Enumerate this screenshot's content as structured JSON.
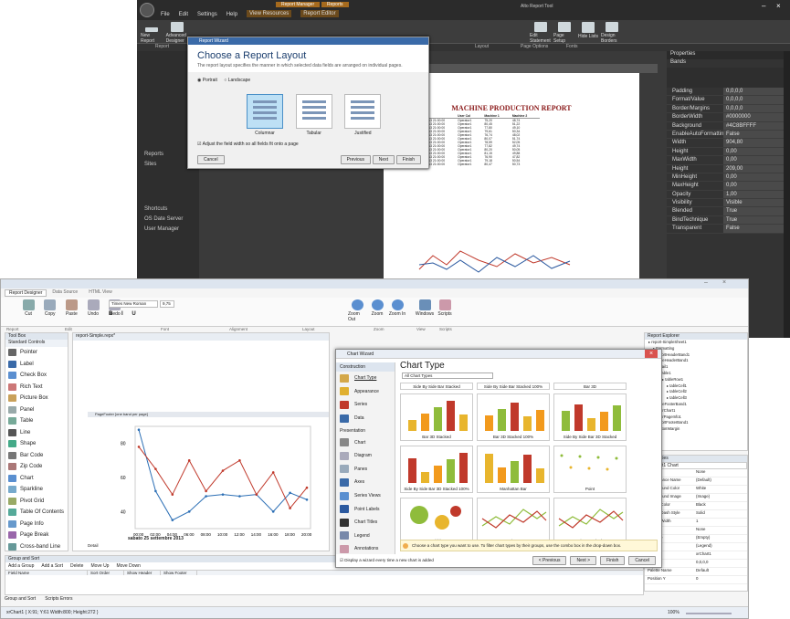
{
  "dark_window": {
    "tabs": [
      "File",
      "Edit",
      "Settings",
      "Help",
      "View Resources",
      "Report Editor"
    ],
    "context_tabs": [
      "Report Manager",
      "Reports"
    ],
    "title": "Alto Report Tool",
    "ribbon_groups": [
      "Report",
      "Layout",
      "Page Options",
      "Fonts"
    ],
    "ribbon_buttons": [
      "New Report Wizard",
      "Advanced Designer",
      "Edit Statement",
      "Page Setup",
      "Hide Lists",
      "Design Borders"
    ],
    "left_tree": [
      "Reports",
      "Sites",
      "Shortcuts",
      "OS Date Server",
      "User Manager"
    ],
    "report_title": "MACHINE PRODUCTION REPORT",
    "report_columns": [
      "Date Col",
      "User Col",
      "Machine 1",
      "Machine 2"
    ],
    "report_rows": [
      [
        "19/02/2013 21:00:00",
        "Operator1",
        "75,20",
        "48,74"
      ],
      [
        "19/02/2013 21:00:00",
        "Operator1",
        "80,45",
        "51,22"
      ],
      [
        "19/02/2013 21:00:00",
        "Operator1",
        "77,80",
        "49,10"
      ],
      [
        "19/02/2013 21:00:00",
        "Operator1",
        "79,61",
        "50,34"
      ],
      [
        "19/02/2013 21:00:00",
        "Operator1",
        "76,74",
        "48,02"
      ],
      [
        "19/02/2013 21:00:00",
        "Operator1",
        "80,07",
        "51,74"
      ],
      [
        "19/02/2013 21:00:00",
        "Operator1",
        "78,59",
        "52,05"
      ],
      [
        "19/02/2013 21:00:00",
        "Operator1",
        "77,82",
        "49,74"
      ],
      [
        "19/02/2013 21:00:00",
        "Operator1",
        "80,20",
        "50,05"
      ],
      [
        "19/02/2013 21:00:00",
        "Operator1",
        "81,15",
        "49,88"
      ],
      [
        "19/02/2013 21:00:00",
        "Operator1",
        "76,90",
        "47,82"
      ],
      [
        "19/02/2013 21:00:00",
        "Operator1",
        "79,18",
        "50,54"
      ],
      [
        "19/02/2013 21:00:00",
        "Operator1",
        "80,47",
        "50,73"
      ]
    ],
    "properties_title": "Properties",
    "properties_section": "Bands",
    "properties": [
      [
        "Padding",
        "0,0,0,0"
      ],
      [
        "Format/Value",
        "0,0,0,0"
      ],
      [
        "Border/Margins",
        "0,0,0,0"
      ],
      [
        "BorderWidth",
        "#0000000"
      ],
      [
        "Background",
        "#4C8BFFFF"
      ],
      [
        "EnableAutoFormatting",
        "False"
      ],
      [
        "Width",
        "904,80"
      ],
      [
        "Height",
        "0,00"
      ],
      [
        "MaxWidth",
        "0,00"
      ],
      [
        "Height",
        "209,00"
      ],
      [
        "MinHeight",
        "0,00"
      ],
      [
        "MaxHeight",
        "0,00"
      ],
      [
        "Opacity",
        "1,00"
      ],
      [
        "Visibility",
        "Visible"
      ],
      [
        "Blended",
        "True"
      ],
      [
        "BindTechnique",
        "True"
      ],
      [
        "Transparent",
        "False"
      ]
    ]
  },
  "report_wizard": {
    "window_title": "Report Wizard",
    "title": "Choose a Report Layout",
    "subtitle": "The report layout specifies the manner in which selected data fields are arranged on individual pages.",
    "orientation_options": [
      "Portrait",
      "Landscape"
    ],
    "layouts": [
      "Columnar",
      "Tabular",
      "Justified"
    ],
    "adjust_label": "Adjust the field width so all fields fit onto a page",
    "buttons": [
      "Cancel",
      "Previous",
      "Next",
      "Finish"
    ]
  },
  "light_window": {
    "tabs": [
      "Report Designer",
      "Data Source",
      "HTML View"
    ],
    "ribbon_buttons": [
      "Cut",
      "Copy",
      "Paste",
      "Undo",
      "Redo",
      "Zoom Out",
      "Zoom",
      "Zoom In",
      "Windows",
      "Scripts"
    ],
    "ribbon_groups": [
      "Report",
      "Edit",
      "Font",
      "Alignment",
      "Layout",
      "Zoom",
      "View",
      "Scripts"
    ],
    "font_name": "Times New Roman",
    "font_size": "9,75",
    "document_tab": "report-Simple.repx*",
    "toolbox_title": "Tool Box",
    "toolbox_section": "Standard Controls",
    "toolbox_items": [
      "Pointer",
      "Label",
      "Check Box",
      "Rich Text",
      "Picture Box",
      "Panel",
      "Table",
      "Line",
      "Shape",
      "Bar Code",
      "Zip Code",
      "Chart",
      "Sparkline",
      "Pivot Grid",
      "Table Of Contents",
      "Page Info",
      "Page Break",
      "Cross-band Line"
    ],
    "band_label": "PageFooter [one band per page]",
    "chart_date": "sabato 25 settembre 2013",
    "detail_label": "Detail",
    "chart_points_blue": [
      [
        "00:00",
        88
      ],
      [
        "02:00",
        52
      ],
      [
        "04:00",
        35
      ],
      [
        "06:00",
        40
      ],
      [
        "08:00",
        49
      ],
      [
        "10:00",
        50
      ],
      [
        "12:00",
        49
      ],
      [
        "14:00",
        50
      ],
      [
        "16:00",
        40
      ],
      [
        "18:00",
        51
      ],
      [
        "20:00",
        47
      ]
    ],
    "chart_points_red": [
      [
        "00:00",
        78
      ],
      [
        "02:00",
        65
      ],
      [
        "04:00",
        50
      ],
      [
        "06:00",
        70
      ],
      [
        "08:00",
        52
      ],
      [
        "10:00",
        64
      ],
      [
        "12:00",
        70
      ],
      [
        "14:00",
        50
      ],
      [
        "16:00",
        63
      ],
      [
        "18:00",
        42
      ],
      [
        "20:00",
        54
      ]
    ],
    "group_sort_title": "Group and Sort",
    "group_buttons": [
      "Add a Group",
      "Add a Sort",
      "Delete",
      "Move Up",
      "Move Down"
    ],
    "group_columns": [
      "Field Name",
      "Sort Order",
      "Show Header",
      "Show Footer"
    ],
    "bottom_tabs": [
      "Group and Sort",
      "Scripts Errors"
    ],
    "status_text": "xrChart1 { X:91; Y:61 Width:800; Height:272 }",
    "zoom": "100%",
    "explorer_title": "Report Explorer",
    "explorer_items": [
      "report-SimpleSheet1",
      "Formatting",
      "reportHeaderBand1",
      "pageHeaderBand1",
      "Detail1",
      "table1",
      "tableRow1",
      "tableCell1",
      "tableCell2",
      "tableCell3",
      "pageFooterBand1",
      "xrChart1",
      "xrPageInfo1",
      "reportFooterBand1",
      "BottomMargin"
    ],
    "props_title": "Properties",
    "props_object": "xrChart1  Chart",
    "props": [
      [
        "Anchor",
        "None"
      ],
      [
        "Appearance Name",
        "(Default)"
      ],
      [
        "Background Color",
        "White"
      ],
      [
        "Background Image",
        "(Image)"
      ],
      [
        "Border Color",
        "Black"
      ],
      [
        "Border Dash Style",
        "Solid"
      ],
      [
        "Border Width",
        "1"
      ],
      [
        "Borders",
        "None"
      ],
      [
        "Fill Style",
        "(Empty)"
      ],
      [
        "Legend",
        "(Legend)"
      ],
      [
        "Name",
        "xrChart1"
      ],
      [
        "Padding",
        "0,0,0,0"
      ],
      [
        "Palette Name",
        "Default"
      ],
      [
        "Position Y",
        "0"
      ]
    ]
  },
  "chart_wizard": {
    "window_title": "Chart Wizard",
    "nav_section1": "Construction",
    "nav_items1": [
      "Chart Type",
      "Appearance",
      "Series",
      "Data"
    ],
    "nav_section2": "Presentation",
    "nav_items2": [
      "Chart",
      "Diagram",
      "Panes",
      "Axes",
      "Series Views",
      "Point Labels",
      "Chart Titles",
      "Legend",
      "Annotations"
    ],
    "title": "Chart Type",
    "filter": "All Chart Types",
    "top_tiles": [
      "Side By Side Bar Stacked",
      "Side By Side Bar Stacked 100%",
      "Bar 3D"
    ],
    "tiles": [
      "Bar 3D Stacked",
      "Bar 3D Stacked 100%",
      "Side By Side Bar 3D Stacked",
      "Side By Side Bar 3D Stacked 100%",
      "Manhattan Bar",
      "Point",
      "Bubble",
      "Line",
      "Line Stacked"
    ],
    "hint": "Choose a chart type you want to use. To filter chart types by their groups, use the combo box in the drop-down box.",
    "display_label": "Display a wizard every time a new chart is added",
    "buttons": [
      "< Previous",
      "Next >",
      "Finish",
      "Cancel"
    ]
  }
}
